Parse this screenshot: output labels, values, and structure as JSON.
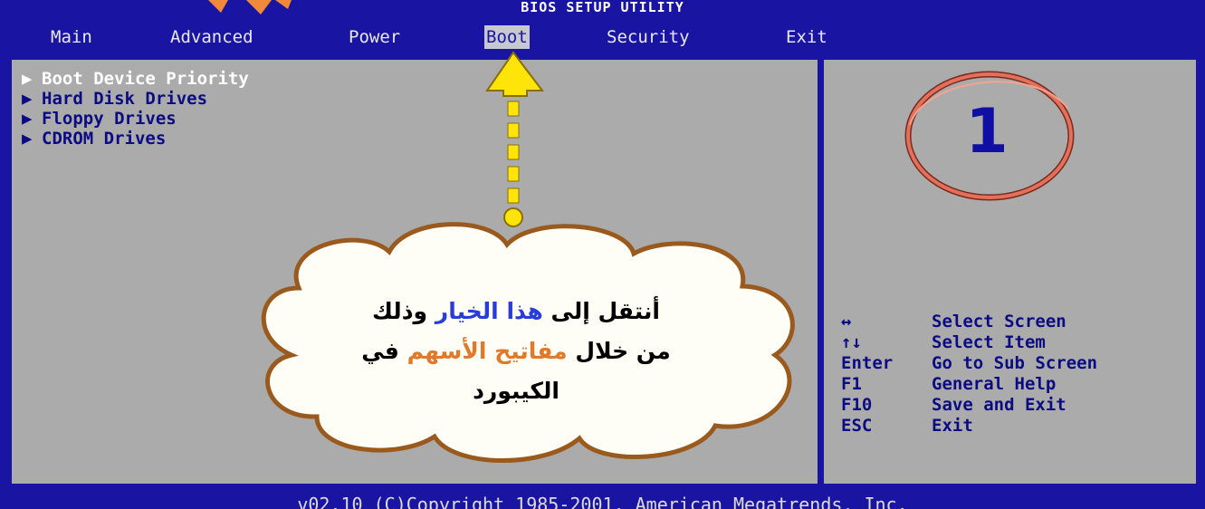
{
  "header": {
    "title": "BIOS SETUP UTILITY",
    "tabs": [
      "Main",
      "Advanced",
      "Power",
      "Boot",
      "Security",
      "Exit"
    ],
    "active_tab": "Boot"
  },
  "boot_menu": {
    "items": [
      {
        "label": "Boot Device Priority",
        "selected": true
      },
      {
        "label": "Hard Disk Drives",
        "selected": false
      },
      {
        "label": "Floppy Drives",
        "selected": false
      },
      {
        "label": "CDROM Drives",
        "selected": false
      }
    ]
  },
  "help": {
    "rows": [
      {
        "key": "↔",
        "action": "Select Screen"
      },
      {
        "key": "↑↓",
        "action": "Select Item"
      },
      {
        "key": "Enter",
        "action": "Go to Sub Screen"
      },
      {
        "key": "F1",
        "action": "General Help"
      },
      {
        "key": "F10",
        "action": "Save and Exit"
      },
      {
        "key": "ESC",
        "action": "Exit"
      }
    ]
  },
  "footer": {
    "copyright": "v02.10 (C)Copyright 1985-2001, American Megatrends, Inc."
  },
  "annotation": {
    "step_number": "1",
    "line1_part1": "أنتقل إلى",
    "line1_highlight": "هذا الخيار",
    "line1_part2": "وذلك",
    "line2_part1": "من خلال",
    "line2_highlight": "مفاتيح الأسهم",
    "line2_part2": "في",
    "line3": "الكيبورد"
  },
  "colors": {
    "bios_blue": "#1a14a3",
    "panel_gray": "#ababab",
    "arrow_yellow": "#ffe40a",
    "highlight_blue": "#2a3cd8",
    "highlight_orange": "#e07a2a",
    "circle_red": "#c84a3a"
  },
  "icons": {
    "item_marker": "right-triangle-icon",
    "annotation_arrow": "up-arrow-icon",
    "step_badge": "circle-badge-icon"
  }
}
